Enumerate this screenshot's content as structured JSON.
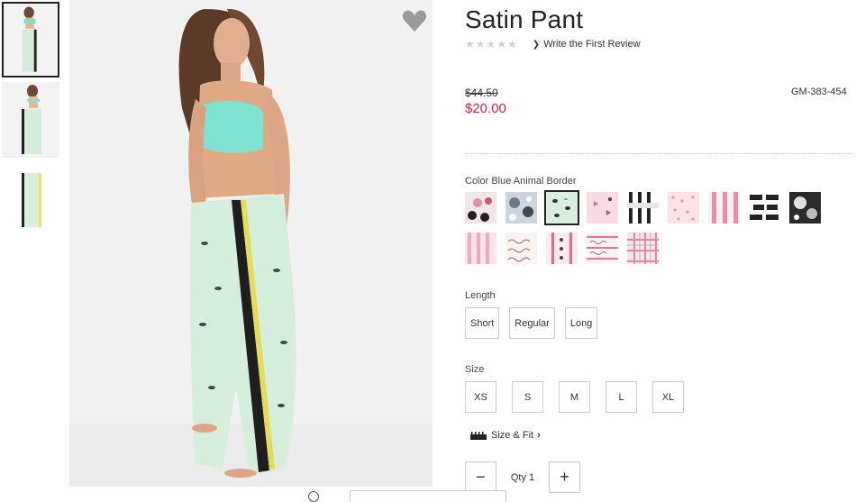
{
  "product": {
    "title": "Satin Pant",
    "stars": "★★★★★",
    "review_link": "Write the First Review",
    "price_old": "$44.50",
    "price_new": "$20.00",
    "sku": "GM-383-454"
  },
  "color": {
    "label": "Color Blue Animal Border",
    "selected_index": 2,
    "swatches": [
      {
        "name": "Pink Floral Black"
      },
      {
        "name": "Grey Floral"
      },
      {
        "name": "Blue Animal Border"
      },
      {
        "name": "Pink Butterfly"
      },
      {
        "name": "Black White Stripe"
      },
      {
        "name": "Pink Dot Print"
      },
      {
        "name": "Pink Grey Stripe"
      },
      {
        "name": "Black Logo Print"
      },
      {
        "name": "Black Floral"
      },
      {
        "name": "Pink Stripe"
      },
      {
        "name": "Script Print"
      },
      {
        "name": "Pink Heart Stripe"
      },
      {
        "name": "Script Stripe"
      },
      {
        "name": "Pink Plaid"
      }
    ]
  },
  "length": {
    "label": "Length",
    "options": [
      "Short",
      "Regular",
      "Long"
    ]
  },
  "size": {
    "label": "Size",
    "options": [
      "XS",
      "S",
      "M",
      "L",
      "XL"
    ]
  },
  "fit": {
    "label": "Size & Fit"
  },
  "quantity": {
    "label": "Qty 1",
    "minus": "−",
    "plus": "+"
  },
  "icons": {
    "favorite": "heart-icon",
    "review_chevron": "chevron-right-icon",
    "fit": "ruler-icon"
  },
  "colors": {
    "sale_price": "#d6195a",
    "border": "#cccccc",
    "heart": "#9a9a9a"
  }
}
